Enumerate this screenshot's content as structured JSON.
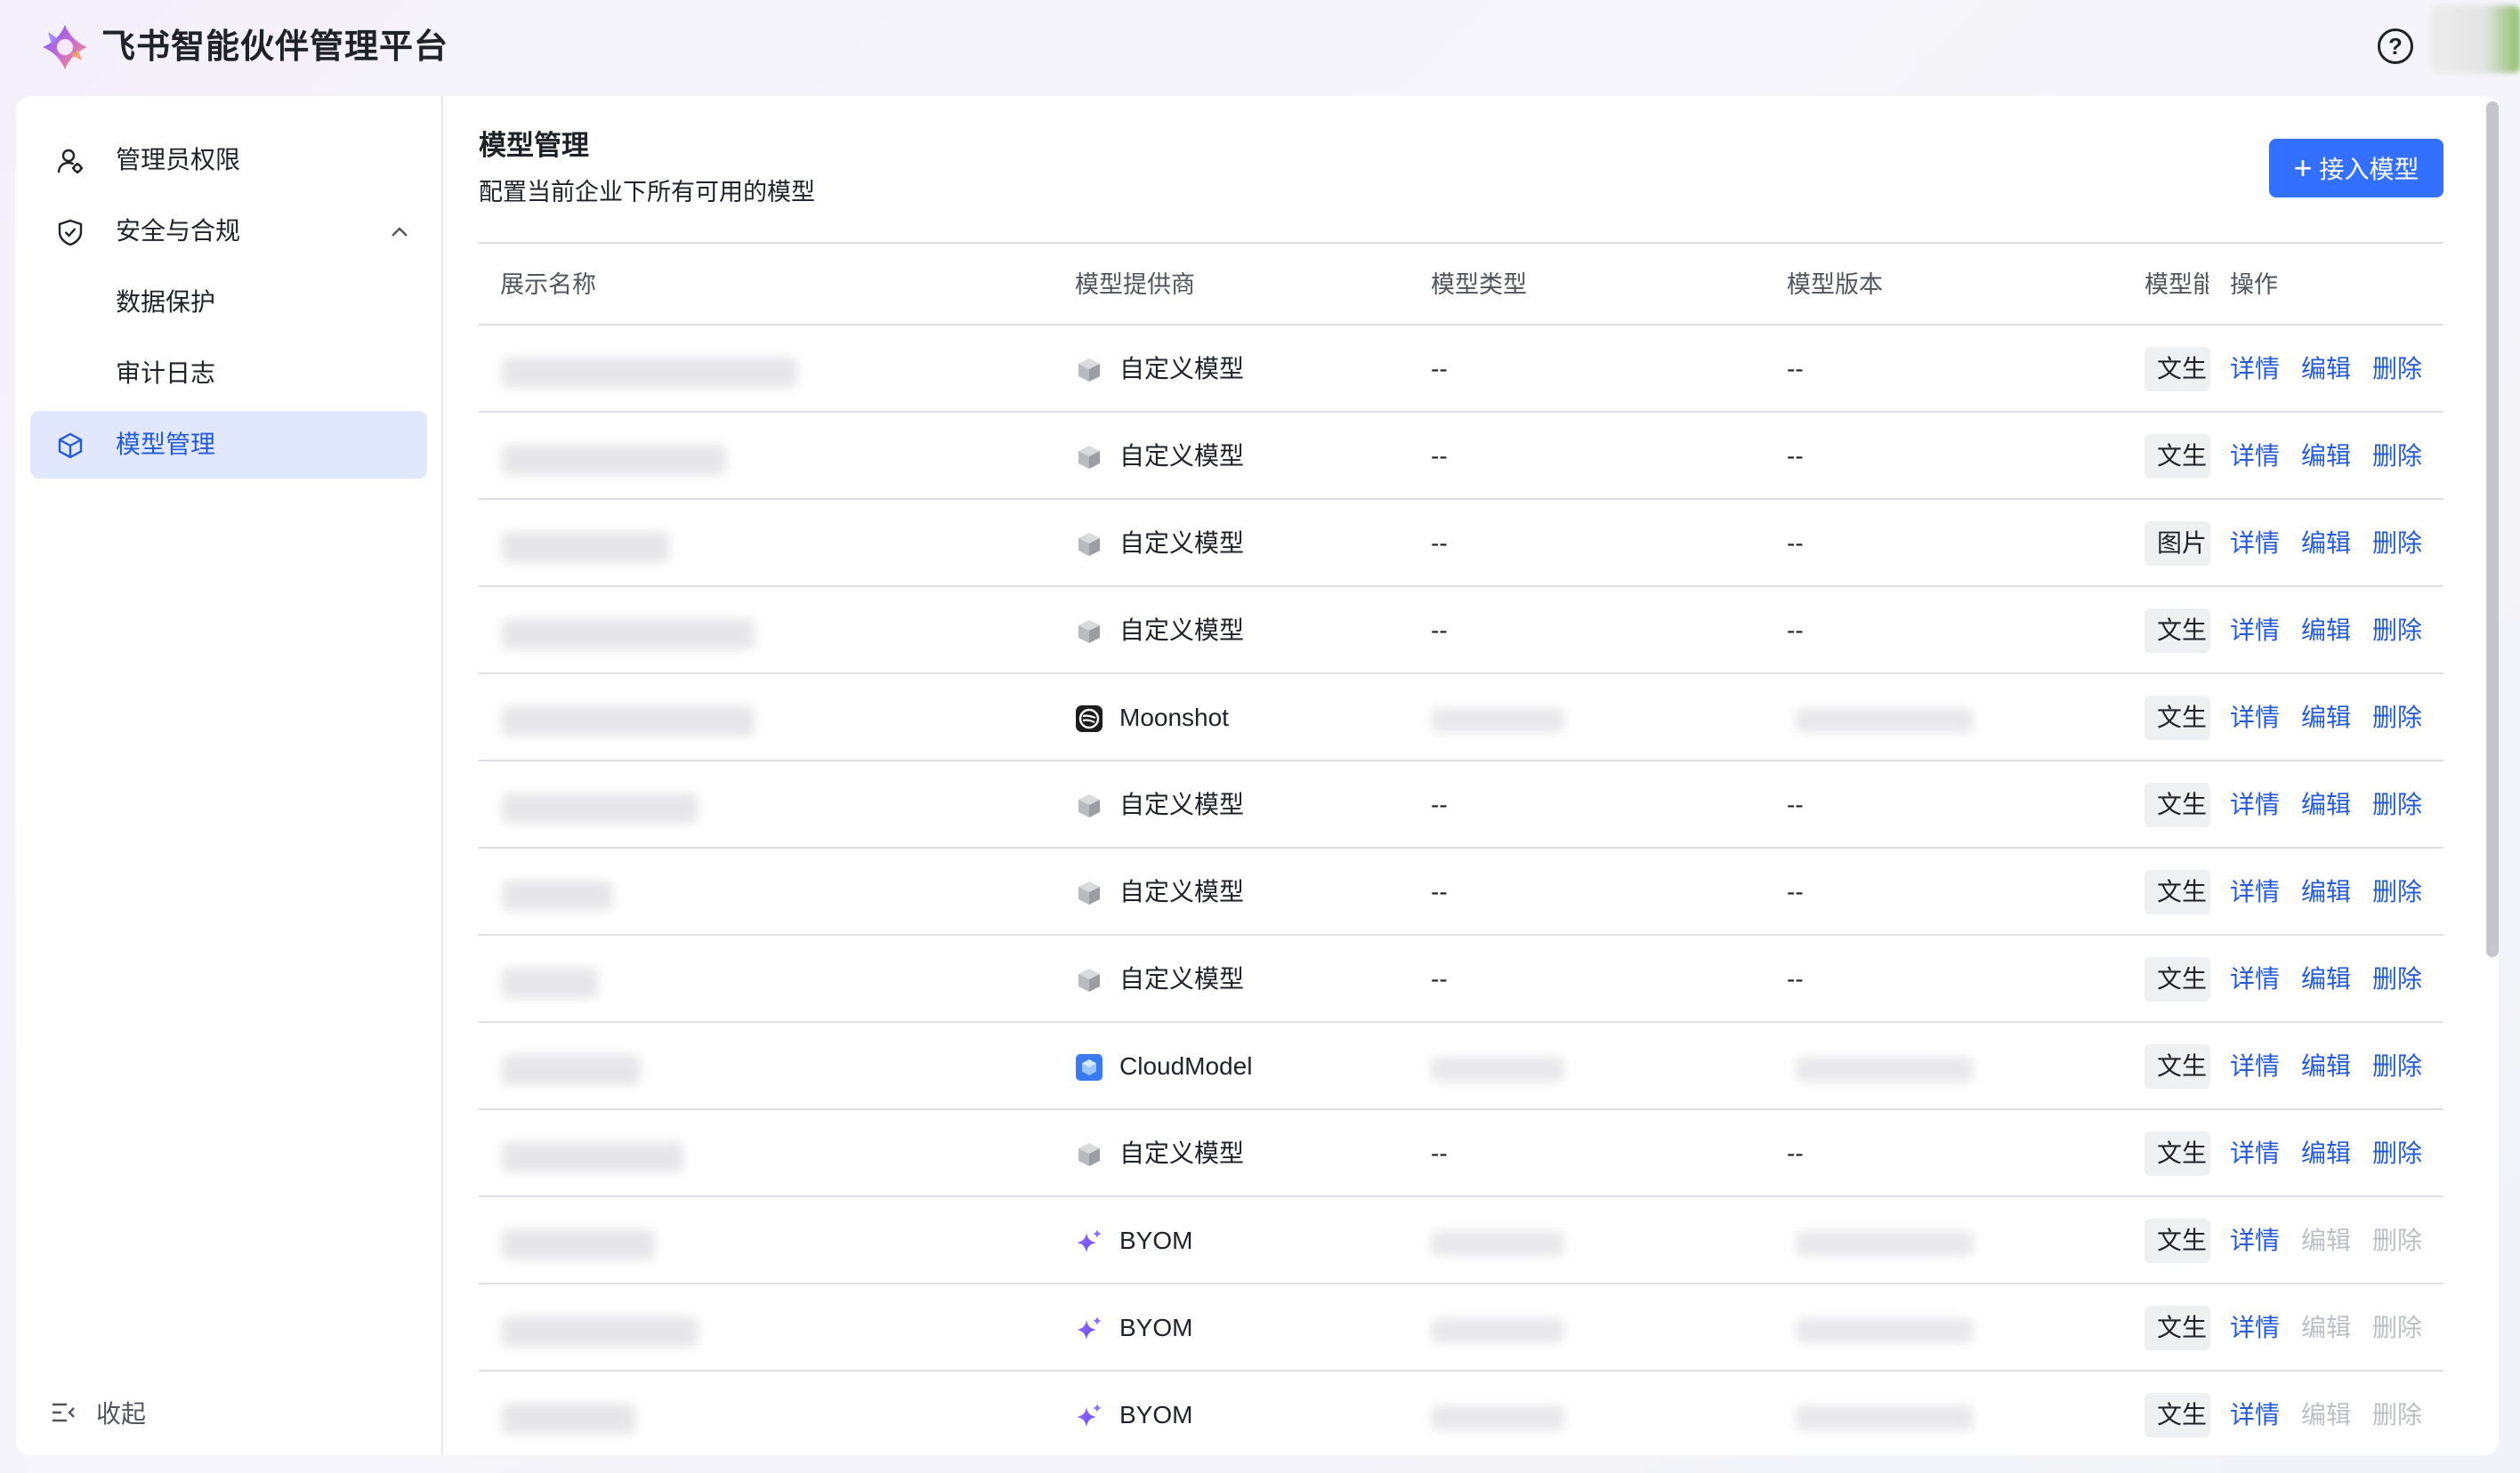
{
  "app": {
    "title": "飞书智能伙伴管理平台",
    "help_symbol": "?"
  },
  "colors": {
    "accent": "#3370ff",
    "active_bg": "#e1e8fd",
    "link": "#245bdb",
    "disabled": "#bbbfc4"
  },
  "sidebar": {
    "items": [
      {
        "label": "管理员权限",
        "icon": "admin-user-icon"
      },
      {
        "label": "安全与合规",
        "icon": "shield-icon",
        "expanded": true
      },
      {
        "label": "数据保护",
        "sub": true
      },
      {
        "label": "审计日志",
        "sub": true
      },
      {
        "label": "模型管理",
        "icon": "cube-icon",
        "active": true
      }
    ],
    "collapse_label": "收起"
  },
  "main": {
    "title": "模型管理",
    "description": "配置当前企业下所有可用的模型",
    "add_button": "接入模型",
    "add_symbol": "+",
    "columns": [
      "展示名称",
      "模型提供商",
      "模型类型",
      "模型版本",
      "模型能",
      "操作"
    ],
    "actions": {
      "detail": "详情",
      "edit": "编辑",
      "delete": "删除"
    },
    "rows": [
      {
        "provider": "自定义模型",
        "provider_icon": "custom-model-icon",
        "type": "--",
        "version": "--",
        "capability": "文生",
        "name_blur": 0.85,
        "editable": true
      },
      {
        "provider": "自定义模型",
        "provider_icon": "custom-model-icon",
        "type": "--",
        "version": "--",
        "capability": "文生",
        "name_blur": 0.6,
        "editable": true
      },
      {
        "provider": "自定义模型",
        "provider_icon": "custom-model-icon",
        "type": "--",
        "version": "--",
        "capability": "图片",
        "name_blur": 0.4,
        "editable": true
      },
      {
        "provider": "自定义模型",
        "provider_icon": "custom-model-icon",
        "type": "--",
        "version": "--",
        "capability": "文生",
        "name_blur": 0.7,
        "editable": true
      },
      {
        "provider": "Moonshot",
        "provider_icon": "moonshot-icon",
        "type": "",
        "version": "",
        "capability": "文生",
        "name_blur": 0.7,
        "editable": true
      },
      {
        "provider": "自定义模型",
        "provider_icon": "custom-model-icon",
        "type": "--",
        "version": "--",
        "capability": "文生",
        "name_blur": 0.5,
        "editable": true
      },
      {
        "provider": "自定义模型",
        "provider_icon": "custom-model-icon",
        "type": "--",
        "version": "--",
        "capability": "文生",
        "name_blur": 0.2,
        "editable": true
      },
      {
        "provider": "自定义模型",
        "provider_icon": "custom-model-icon",
        "type": "--",
        "version": "--",
        "capability": "文生",
        "name_blur": 0.15,
        "editable": true
      },
      {
        "provider": "CloudModel",
        "provider_icon": "cloudmodel-icon",
        "type": "",
        "version": "",
        "capability": "文生",
        "name_blur": 0.3,
        "editable": true
      },
      {
        "provider": "自定义模型",
        "provider_icon": "custom-model-icon",
        "type": "--",
        "version": "--",
        "capability": "文生",
        "name_blur": 0.45,
        "editable": true
      },
      {
        "provider": "BYOM",
        "provider_icon": "byom-sparkle-icon",
        "type": "",
        "version": "",
        "capability": "文生",
        "name_blur": 0.35,
        "editable": false
      },
      {
        "provider": "BYOM",
        "provider_icon": "byom-sparkle-icon",
        "type": "",
        "version": "",
        "capability": "文生",
        "name_blur": 0.5,
        "editable": false
      },
      {
        "provider": "BYOM",
        "provider_icon": "byom-sparkle-icon",
        "type": "",
        "version": "",
        "capability": "文生",
        "name_blur": 0.28,
        "editable": false
      }
    ]
  }
}
